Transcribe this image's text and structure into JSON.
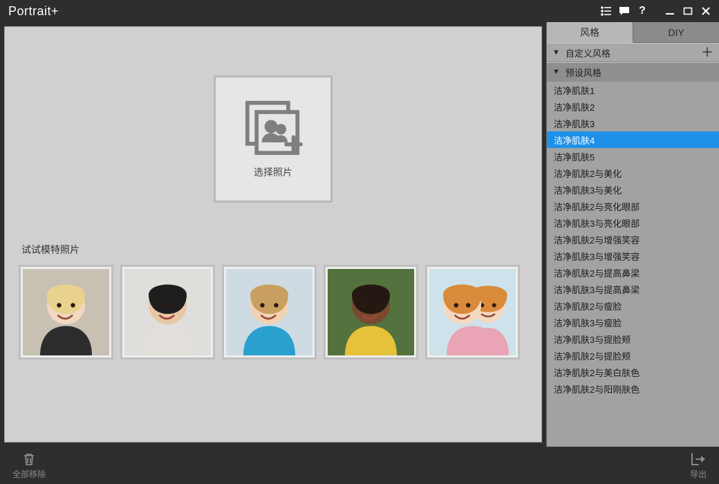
{
  "app": {
    "title": "Portrait+"
  },
  "titlebar_icons": [
    "list",
    "chat",
    "help",
    "minimize",
    "maximize",
    "close"
  ],
  "canvas": {
    "dropzone_label": "选择照片",
    "samples_heading": "试试模特照片",
    "sample_count": 5
  },
  "side": {
    "tabs": [
      {
        "id": "style",
        "label": "风格",
        "active": true
      },
      {
        "id": "diy",
        "label": "DIY",
        "active": false
      }
    ],
    "custom_section": {
      "label": "自定义风格",
      "expanded": true,
      "has_add": true
    },
    "preset_section": {
      "label": "预设风格",
      "expanded": true
    },
    "presets": [
      "洁净肌肤1",
      "洁净肌肤2",
      "洁净肌肤3",
      "洁净肌肤4",
      "洁净肌肤5",
      "洁净肌肤2与美化",
      "洁净肌肤3与美化",
      "洁净肌肤2与亮化眼部",
      "洁净肌肤3与亮化眼部",
      "洁净肌肤2与增强笑容",
      "洁净肌肤3与增强笑容",
      "洁净肌肤2与提高鼻梁",
      "洁净肌肤3与提高鼻梁",
      "洁净肌肤2与瘦脸",
      "洁净肌肤3与瘦脸",
      "洁净肌肤3与提脸颊",
      "洁净肌肤2与提脸颊",
      "洁净肌肤2与美白肤色",
      "洁净肌肤2与阳刚肤色"
    ],
    "selected_preset_index": 3
  },
  "footer": {
    "remove_all": "全部移除",
    "export": "导出"
  },
  "colors": {
    "chrome": "#2e2e2e",
    "canvas": "#d0d0d0",
    "panel": "#9f9f9f",
    "accent": "#1e90e8"
  },
  "sample_faces": [
    {
      "skin": "#f1d8c1",
      "hair": "#e8d28e",
      "bg_top": "#d8d2c6",
      "bg_bot": "#b7ad9f",
      "shirt": "#2d2d2d"
    },
    {
      "skin": "#e8c6a2",
      "hair": "#1e1e1e",
      "bg_top": "#ecebe8",
      "bg_bot": "#d4d2cd",
      "shirt": "#e2dfda"
    },
    {
      "skin": "#f3d2b4",
      "hair": "#caa062",
      "bg_top": "#d9e4ea",
      "bg_bot": "#c3d2db",
      "shirt": "#2aa0cf"
    },
    {
      "skin": "#7a4a2e",
      "hair": "#241812",
      "bg_top": "#6a8a4d",
      "bg_bot": "#3e5a2e",
      "shirt": "#e6c23a"
    },
    {
      "skin": "#f5d8c0",
      "hair": "#d98a3a",
      "bg_top": "#dfeef4",
      "bg_bot": "#bcd6e0",
      "shirt": "#e9a4b6"
    }
  ]
}
